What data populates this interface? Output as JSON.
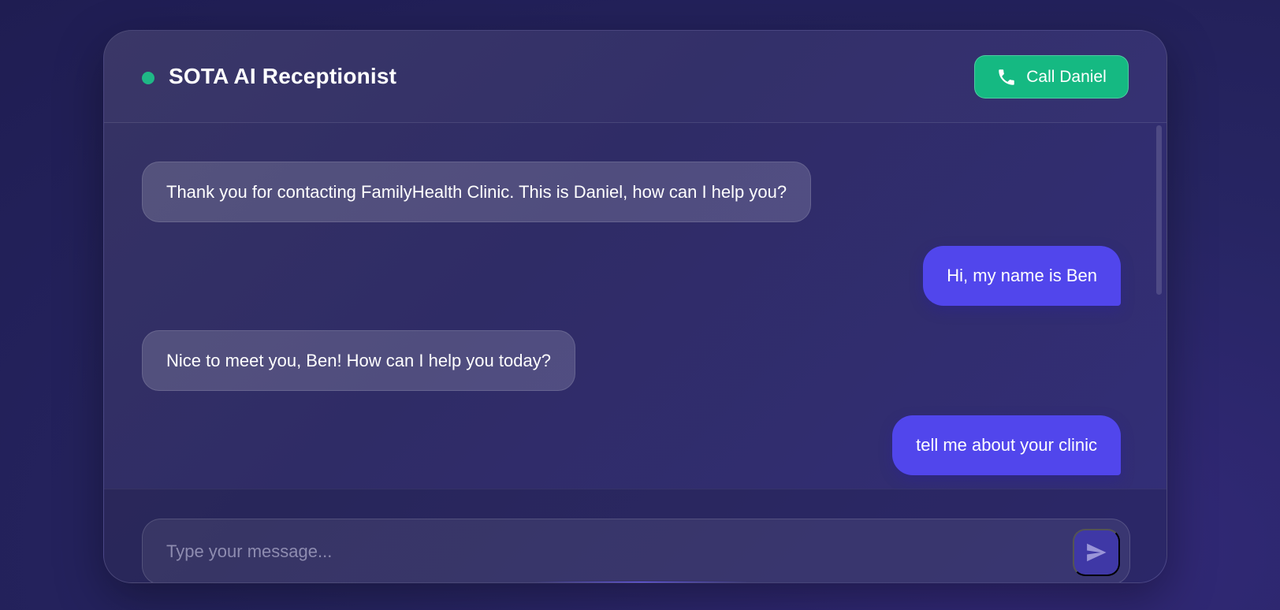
{
  "header": {
    "status": "online",
    "title": "SOTA AI Receptionist",
    "call_button_label": "Call Daniel",
    "call_icon": "phone-icon"
  },
  "messages": [
    {
      "sender": "bot",
      "text": "Thank you for contacting FamilyHealth Clinic. This is Daniel, how can I help you?"
    },
    {
      "sender": "user",
      "text": "Hi, my name is Ben"
    },
    {
      "sender": "bot",
      "text": "Nice to meet you, Ben! How can I help you today?"
    },
    {
      "sender": "user",
      "text": "tell me about your clinic"
    }
  ],
  "composer": {
    "placeholder": "Type your message...",
    "value": "",
    "send_icon": "send-icon"
  },
  "colors": {
    "accent_green": "#15b982",
    "user_bubble": "#5146ec",
    "send_button": "#3f38a6",
    "background": "#272563"
  }
}
